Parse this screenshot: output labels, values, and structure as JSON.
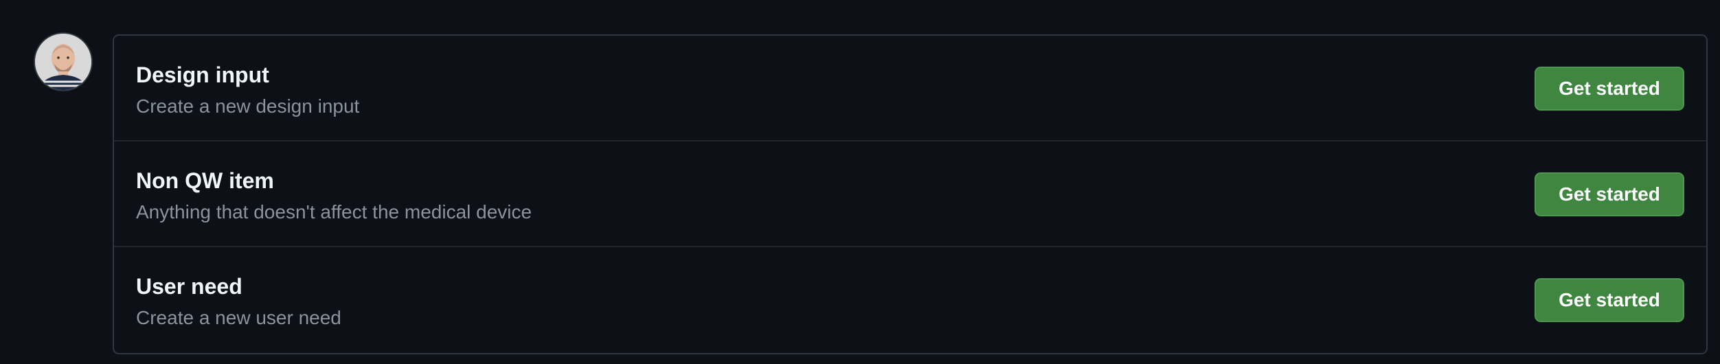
{
  "user": {
    "avatar_icon": "user-avatar-photo"
  },
  "items": [
    {
      "title": "Design input",
      "description": "Create a new design input",
      "button_label": "Get started"
    },
    {
      "title": "Non QW item",
      "description": "Anything that doesn't affect the medical device",
      "button_label": "Get started"
    },
    {
      "title": "User need",
      "description": "Create a new user need",
      "button_label": "Get started"
    }
  ],
  "colors": {
    "background": "#0d1117",
    "border": "#30363d",
    "title_text": "#f0f6fc",
    "muted_text": "#8b949e",
    "button_bg": "#3f8641"
  }
}
